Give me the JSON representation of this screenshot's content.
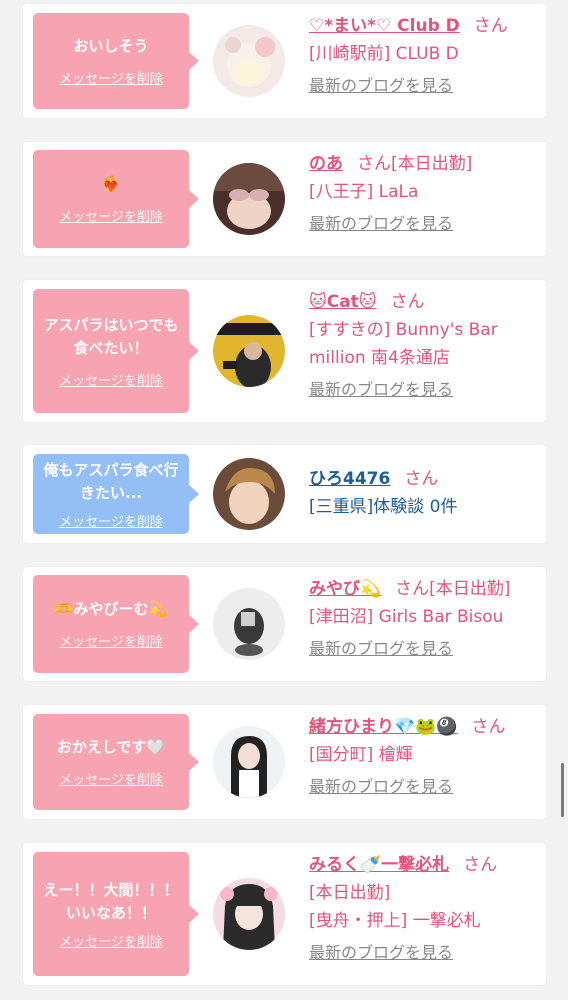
{
  "colors": {
    "pink_bubble": "#f7a3b2",
    "blue_bubble": "#94bff5",
    "pink_text": "#e5537b",
    "blue_text": "#1d5d96",
    "blog_link": "#888888"
  },
  "delete_label": "メッセージを削除",
  "blog_label": "最新のブログを見る",
  "san_label": "さん",
  "items": [
    {
      "message": "おいしそう",
      "name": "♡*まい*♡ Club D",
      "status": "",
      "details": [
        "[川崎駅前] CLUB D"
      ],
      "has_blog": true,
      "theme": "pink"
    },
    {
      "message": "❤️‍🔥",
      "name": "のあ",
      "status": "[本日出勤]",
      "details": [
        "[八王子] LaLa"
      ],
      "has_blog": true,
      "theme": "pink"
    },
    {
      "message": "アスパラはいつでも食べたい！",
      "name": "🐱Cat🐱",
      "status": "",
      "details": [
        "[すすきの] Bunny's Bar",
        "million 南4条通店"
      ],
      "has_blog": true,
      "theme": "pink"
    },
    {
      "message": "俺もアスパラ食べ行きたい...",
      "name": "ひろ4476",
      "status": "",
      "details": [
        "[三重県]体験談 0件"
      ],
      "has_blog": false,
      "theme": "blue"
    },
    {
      "message": "🫶みやびーむ💫",
      "name": "みやび💫",
      "status": "[本日出勤]",
      "details": [
        "[津田沼] Girls Bar Bisou"
      ],
      "has_blog": true,
      "theme": "pink"
    },
    {
      "message": "おかえしです🤍",
      "name": "緒方ひまり💎🐸🎱",
      "status": "",
      "details": [
        "[国分町] 檜輝"
      ],
      "has_blog": true,
      "theme": "pink"
    },
    {
      "message": "えー！！大間！！！いいなあ！！",
      "name": "みるく🍼一撃必札",
      "status": "",
      "details": [
        "[本日出勤]",
        "[曳舟・押上] 一撃必札"
      ],
      "has_blog": true,
      "theme": "pink"
    }
  ]
}
